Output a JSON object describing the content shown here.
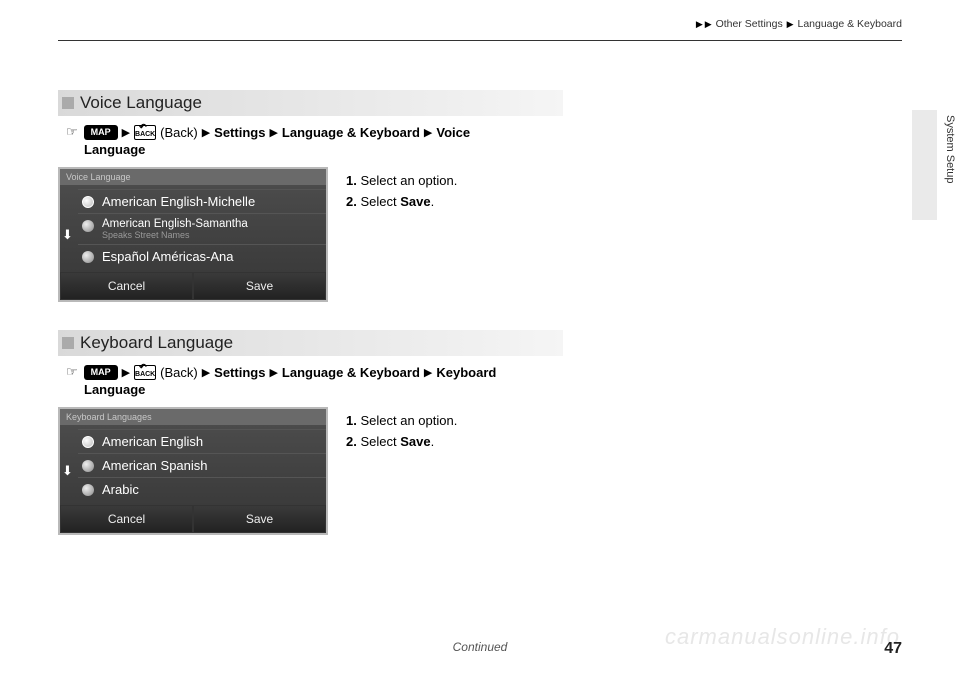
{
  "header": {
    "breadcrumb_1": "Other Settings",
    "breadcrumb_2": "Language & Keyboard"
  },
  "side_tab": {
    "label": "System Setup"
  },
  "sections": [
    {
      "title": "Voice Language",
      "path": {
        "map": "MAP",
        "back_label": "BACK",
        "back_text": "(Back)",
        "seg1": "Settings",
        "seg2": "Language & Keyboard",
        "seg3": "Voice",
        "cont": "Language"
      },
      "ui": {
        "header": "Voice Language",
        "options": [
          {
            "label": "American English-Michelle",
            "sub": "",
            "selected": true
          },
          {
            "label": "American English-Samantha",
            "sub": "Speaks Street Names",
            "selected": false
          },
          {
            "label": "Español Américas-Ana",
            "sub": "",
            "selected": false
          }
        ],
        "cancel": "Cancel",
        "save": "Save"
      },
      "steps": {
        "s1": "Select an option.",
        "s2_a": "Select ",
        "s2_b": "Save",
        "s2_c": "."
      }
    },
    {
      "title": "Keyboard Language",
      "path": {
        "map": "MAP",
        "back_label": "BACK",
        "back_text": "(Back)",
        "seg1": "Settings",
        "seg2": "Language & Keyboard",
        "seg3": "Keyboard",
        "cont": "Language"
      },
      "ui": {
        "header": "Keyboard Languages",
        "options": [
          {
            "label": "American English",
            "sub": "",
            "selected": true
          },
          {
            "label": "American Spanish",
            "sub": "",
            "selected": false
          },
          {
            "label": "Arabic",
            "sub": "",
            "selected": false
          }
        ],
        "cancel": "Cancel",
        "save": "Save"
      },
      "steps": {
        "s1": "Select an option.",
        "s2_a": "Select ",
        "s2_b": "Save",
        "s2_c": "."
      }
    }
  ],
  "footer": {
    "continued": "Continued",
    "page": "47",
    "watermark": "carmanualsonline.info"
  }
}
